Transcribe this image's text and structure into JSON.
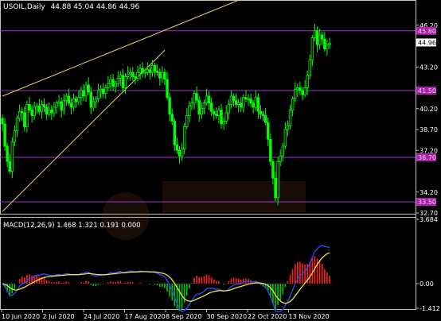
{
  "window": {
    "symbol_line": "USOIL,Daily",
    "ohlc": "44.88 45.04 44.86 44.96"
  },
  "colors": {
    "background": "#000000",
    "candle_up": "#00FF00",
    "candle_down": "#00FF00",
    "trendline": "#E8D26A",
    "hline": "#9933CC",
    "price_tag": "#B01CB0",
    "current_tag": "#FFFFFF",
    "macd_main": "#2B4DFF",
    "macd_signal": "#F0E24A",
    "hist_pos": "#FF2020",
    "hist_neg": "#00C800",
    "text": "#FFFFFF",
    "frame": "#C0C0C0"
  },
  "chart_data": [
    {
      "type": "candlestick",
      "panel": "price",
      "ylim": [
        32.7,
        47.9
      ],
      "y_ticks": [
        "46.20",
        "43.20",
        "40.20",
        "38.70",
        "37.20",
        "34.20",
        "32.70"
      ],
      "price_tags": [
        {
          "label": "45.80",
          "value": 45.8
        },
        {
          "label": "41.50",
          "value": 41.5
        },
        {
          "label": "36.70",
          "value": 36.7
        },
        {
          "label": "33.50",
          "value": 33.5
        }
      ],
      "current": {
        "label": "44.96",
        "value": 44.96
      },
      "x_ticks": [
        "10 Jun 2020",
        "2 Jul 2020",
        "24 Jul 2020",
        "17 Aug 2020",
        "8 Sep 2020",
        "30 Sep 2020",
        "22 Oct 2020",
        "13 Nov 2020"
      ],
      "trendlines": [
        {
          "from": [
            0,
            41.1
          ],
          "to": [
            96,
            48.0
          ]
        },
        {
          "from": [
            0,
            32.8
          ],
          "to": [
            66,
            44.4
          ]
        }
      ],
      "closes": [
        39.1,
        37.5,
        36.4,
        35.7,
        37.8,
        38.6,
        39.5,
        40.0,
        39.9,
        38.9,
        40.5,
        40.1,
        39.7,
        40.3,
        40.4,
        40.0,
        40.5,
        40.3,
        39.8,
        40.1,
        39.9,
        40.3,
        40.6,
        40.7,
        40.1,
        40.8,
        41.1,
        40.6,
        40.3,
        40.9,
        40.7,
        41.0,
        41.5,
        41.1,
        41.9,
        41.4,
        40.3,
        40.7,
        40.9,
        41.5,
        41.6,
        41.3,
        41.7,
        42.0,
        42.3,
        41.8,
        42.0,
        42.4,
        42.6,
        41.7,
        42.5,
        42.7,
        42.8,
        42.5,
        42.4,
        42.8,
        43.1,
        42.8,
        42.8,
        43.0,
        42.8,
        43.3,
        42.9,
        42.8,
        42.4,
        42.8,
        42.3,
        41.0,
        39.8,
        39.3,
        37.6,
        37.2,
        36.8,
        37.3,
        38.9,
        39.7,
        40.4,
        40.6,
        41.3,
        40.8,
        39.8,
        40.2,
        40.6,
        41.1,
        40.6,
        40.0,
        39.8,
        39.7,
        40.1,
        39.1,
        39.3,
        39.9,
        40.5,
        41.1,
        40.8,
        40.5,
        40.6,
        40.3,
        41.0,
        40.9,
        40.9,
        40.6,
        40.3,
        41.0,
        40.0,
        39.8,
        39.7,
        39.2,
        38.0,
        36.4,
        35.2,
        33.8,
        36.4,
        36.8,
        37.5,
        38.7,
        39.0,
        40.1,
        40.9,
        41.6,
        41.7,
        41.5,
        41.2,
        41.7,
        42.6,
        43.7,
        45.3,
        45.8,
        44.8,
        45.5,
        45.2,
        44.5,
        44.8,
        44.9
      ]
    },
    {
      "type": "macd",
      "panel": "indicator",
      "title": "MACD(12,26,9) 1.468 1.321 0.191 0.000",
      "ylim": [
        -1.412,
        3.684
      ],
      "y_ticks": [
        "3.684",
        "0.00",
        "-1.412"
      ],
      "series_meta": [
        {
          "role": "main",
          "color_key": "macd_main"
        },
        {
          "role": "signal",
          "color_key": "macd_signal"
        }
      ]
    }
  ]
}
